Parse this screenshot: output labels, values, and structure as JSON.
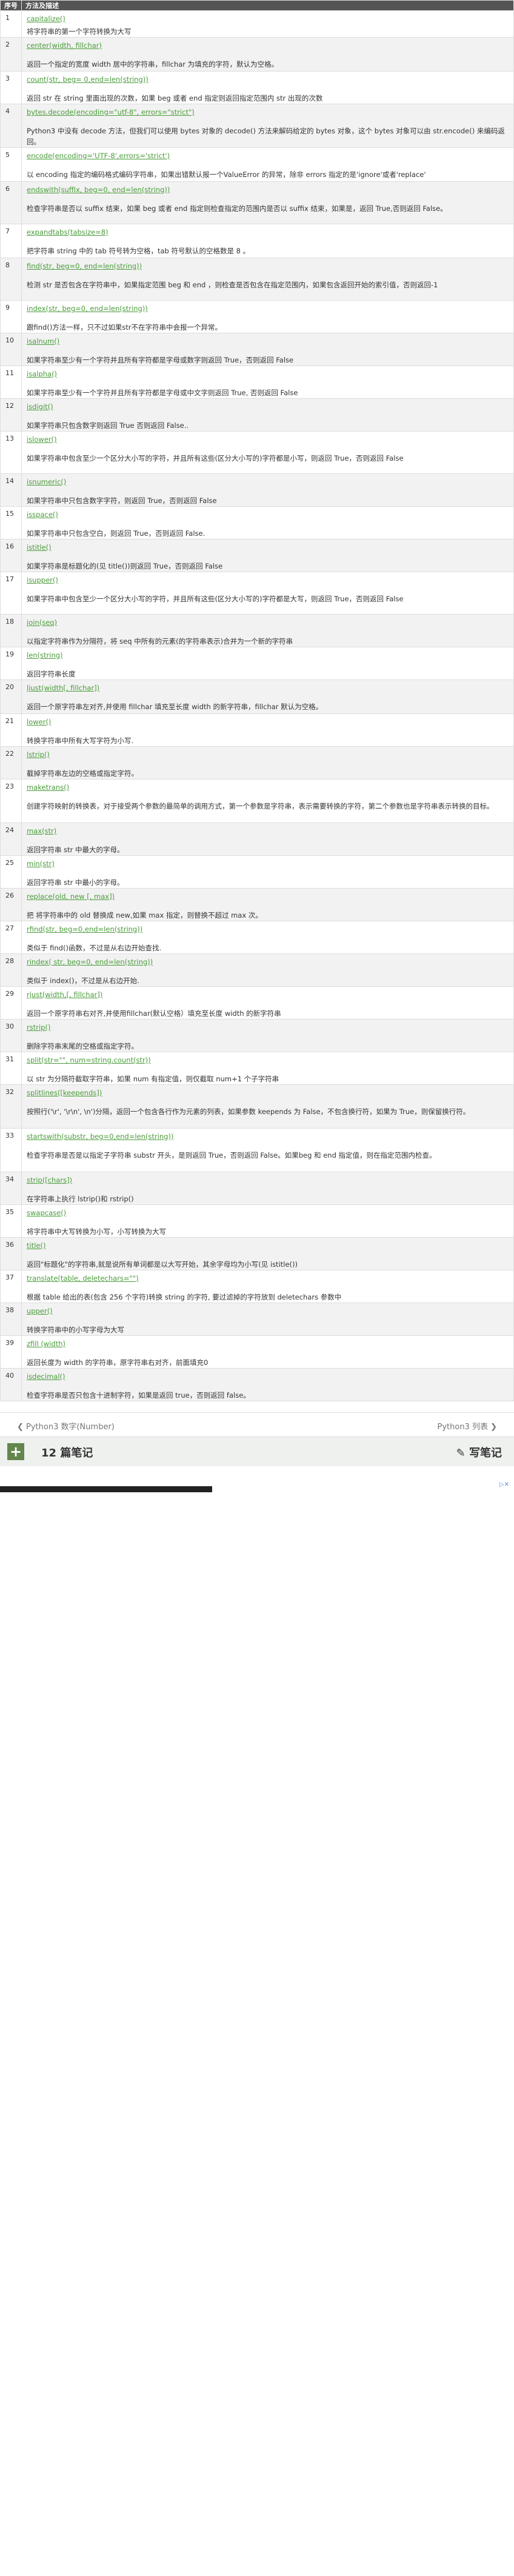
{
  "header": {
    "num": "序号",
    "desc": "方法及描述"
  },
  "rows": [
    {
      "num": "1",
      "method": "capitalize()",
      "desc": "将字符串的第一个字符转换为大写"
    },
    {
      "num": "2",
      "method": "center(width, fillchar)",
      "desc": "返回一个指定的宽度 width 居中的字符串，fillchar 为填充的字符，默认为空格。"
    },
    {
      "num": "3",
      "method": "count(str, beg= 0,end=len(string))",
      "desc": "返回 str 在 string 里面出现的次数，如果 beg 或者 end 指定则返回指定范围内 str 出现的次数"
    },
    {
      "num": "4",
      "method": "bytes.decode(encoding=\"utf-8\", errors=\"strict\")",
      "desc": "Python3 中没有 decode 方法，但我们可以使用 bytes 对象的 decode() 方法来解码给定的 bytes 对象，这个 bytes 对象可以由 str.encode() 来编码返回。"
    },
    {
      "num": "5",
      "method": "encode(encoding='UTF-8',errors='strict')",
      "desc": "以 encoding 指定的编码格式编码字符串，如果出错默认报一个ValueError 的异常，除非 errors 指定的是'ignore'或者'replace'"
    },
    {
      "num": "6",
      "method": "endswith(suffix, beg=0, end=len(string))",
      "desc": "检查字符串是否以 suffix 结束，如果 beg 或者 end 指定则检查指定的范围内是否以 suffix 结束，如果是，返回 True,否则返回 False。"
    },
    {
      "num": "7",
      "method": "expandtabs(tabsize=8)",
      "desc": "把字符串 string 中的 tab 符号转为空格，tab 符号默认的空格数是 8 。"
    },
    {
      "num": "8",
      "method": "find(str, beg=0, end=len(string))",
      "desc": "检测 str 是否包含在字符串中，如果指定范围 beg 和 end ，则检查是否包含在指定范围内，如果包含返回开始的索引值，否则返回-1"
    },
    {
      "num": "9",
      "method": "index(str, beg=0, end=len(string))",
      "desc": "跟find()方法一样，只不过如果str不在字符串中会报一个异常。"
    },
    {
      "num": "10",
      "method": "isalnum()",
      "desc": "如果字符串至少有一个字符并且所有字符都是字母或数字则返回 True，否则返回 False"
    },
    {
      "num": "11",
      "method": "isalpha()",
      "desc": "如果字符串至少有一个字符并且所有字符都是字母或中文字则返回 True, 否则返回 False"
    },
    {
      "num": "12",
      "method": "isdigit()",
      "desc": "如果字符串只包含数字则返回 True 否则返回 False.."
    },
    {
      "num": "13",
      "method": "islower()",
      "desc": "如果字符串中包含至少一个区分大小写的字符，并且所有这些(区分大小写的)字符都是小写，则返回 True，否则返回 False"
    },
    {
      "num": "14",
      "method": "isnumeric()",
      "desc": "如果字符串中只包含数字字符，则返回 True，否则返回 False"
    },
    {
      "num": "15",
      "method": "isspace()",
      "desc": "如果字符串中只包含空白，则返回 True，否则返回 False."
    },
    {
      "num": "16",
      "method": "istitle()",
      "desc": "如果字符串是标题化的(见 title())则返回 True，否则返回 False"
    },
    {
      "num": "17",
      "method": "isupper()",
      "desc": "如果字符串中包含至少一个区分大小写的字符，并且所有这些(区分大小写的)字符都是大写，则返回 True，否则返回 False"
    },
    {
      "num": "18",
      "method": "join(seq)",
      "desc": "以指定字符串作为分隔符，将 seq 中所有的元素(的字符串表示)合并为一个新的字符串"
    },
    {
      "num": "19",
      "method": "len(string)",
      "desc": "返回字符串长度"
    },
    {
      "num": "20",
      "method": "ljust(width[, fillchar])",
      "desc": "返回一个原字符串左对齐,并使用 fillchar 填充至长度 width 的新字符串，fillchar 默认为空格。"
    },
    {
      "num": "21",
      "method": "lower()",
      "desc": "转换字符串中所有大写字符为小写."
    },
    {
      "num": "22",
      "method": "lstrip()",
      "desc": "截掉字符串左边的空格或指定字符。"
    },
    {
      "num": "23",
      "method": "maketrans()",
      "desc": "创建字符映射的转换表，对于接受两个参数的最简单的调用方式，第一个参数是字符串，表示需要转换的字符，第二个参数也是字符串表示转换的目标。"
    },
    {
      "num": "24",
      "method": "max(str)",
      "desc": "返回字符串 str 中最大的字母。"
    },
    {
      "num": "25",
      "method": "min(str)",
      "desc": "返回字符串 str 中最小的字母。"
    },
    {
      "num": "26",
      "method": "replace(old, new [, max])",
      "desc": "把 将字符串中的 old 替换成 new,如果 max 指定，则替换不超过 max 次。"
    },
    {
      "num": "27",
      "method": "rfind(str, beg=0,end=len(string))",
      "desc": "类似于 find()函数，不过是从右边开始查找."
    },
    {
      "num": "28",
      "method": "rindex( str, beg=0, end=len(string))",
      "desc": "类似于 index()，不过是从右边开始."
    },
    {
      "num": "29",
      "method": "rjust(width,[, fillchar])",
      "desc": "返回一个原字符串右对齐,并使用fillchar(默认空格）填充至长度 width 的新字符串"
    },
    {
      "num": "30",
      "method": "rstrip()",
      "desc": "删除字符串末尾的空格或指定字符。"
    },
    {
      "num": "31",
      "method": "split(str=\"\", num=string.count(str))",
      "desc": "以 str 为分隔符截取字符串，如果 num 有指定值，则仅截取 num+1 个子字符串"
    },
    {
      "num": "32",
      "method": "splitlines([keepends])",
      "desc": "按照行('\\r', '\\r\\n', \\n')分隔，返回一个包含各行作为元素的列表，如果参数 keepends 为 False，不包含换行符，如果为 True，则保留换行符。"
    },
    {
      "num": "33",
      "method": "startswith(substr, beg=0,end=len(string))",
      "desc": "检查字符串是否是以指定子字符串 substr 开头，是则返回 True，否则返回 False。如果beg 和 end 指定值，则在指定范围内检查。"
    },
    {
      "num": "34",
      "method": "strip([chars])",
      "desc": "在字符串上执行 lstrip()和 rstrip()"
    },
    {
      "num": "35",
      "method": "swapcase()",
      "desc": "将字符串中大写转换为小写，小写转换为大写"
    },
    {
      "num": "36",
      "method": "title()",
      "desc": "返回\"标题化\"的字符串,就是说所有单词都是以大写开始，其余字母均为小写(见 istitle())"
    },
    {
      "num": "37",
      "method": "translate(table, deletechars=\"\")",
      "desc": "根据 table 给出的表(包含 256 个字符)转换 string 的字符, 要过滤掉的字符放到 deletechars 参数中"
    },
    {
      "num": "38",
      "method": "upper()",
      "desc": "转换字符串中的小写字母为大写"
    },
    {
      "num": "39",
      "method": "zfill (width)",
      "desc": "返回长度为 width 的字符串，原字符串右对齐，前面填充0"
    },
    {
      "num": "40",
      "method": "isdecimal()",
      "desc": "检查字符串是否只包含十进制字符，如果是返回 true，否则返回 false。"
    }
  ],
  "nav": {
    "prev": "❮ Python3 数字(Number)",
    "next": "Python3 列表 ❯"
  },
  "notes": {
    "plus": "+",
    "title": "12 篇笔记",
    "write": "✎ 写笔记"
  },
  "ad": {
    "choices": "▷✕"
  }
}
